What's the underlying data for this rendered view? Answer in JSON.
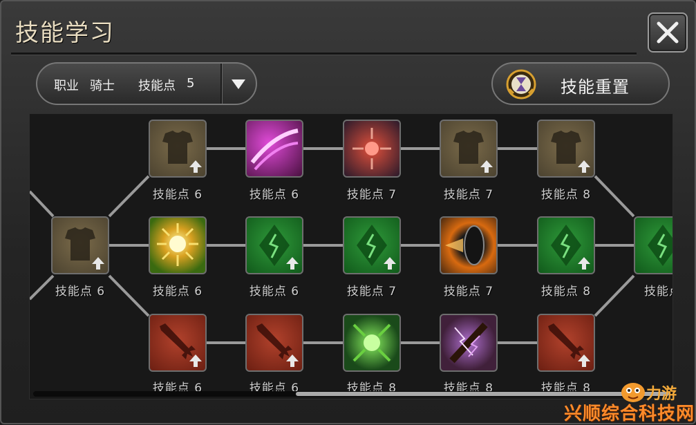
{
  "window": {
    "title": "技能学习",
    "close_icon": "close-icon"
  },
  "class_select": {
    "class_label": "职业",
    "class_value": "骑士",
    "points_label": "技能点",
    "points_value": "5",
    "dropdown_icon": "chevron-down-icon"
  },
  "reset_button": {
    "label": "技能重置",
    "icon": "hourglass-emblem-icon"
  },
  "skill_tree": {
    "nodes": [
      {
        "id": "r2c0",
        "icon": "armor-icon",
        "cost_text": "技能点 6",
        "upgrade": true
      },
      {
        "id": "r1c1",
        "icon": "armor-icon",
        "cost_text": "技能点 6",
        "upgrade": true
      },
      {
        "id": "r2c1",
        "icon": "sunburst-icon",
        "cost_text": "技能点 6",
        "upgrade": false
      },
      {
        "id": "r3c1",
        "icon": "sword-icon",
        "cost_text": "技能点 6",
        "upgrade": true
      },
      {
        "id": "r1c2",
        "icon": "purple-slash-icon",
        "cost_text": "技能点 6",
        "upgrade": false
      },
      {
        "id": "r2c2",
        "icon": "green-rune-icon",
        "cost_text": "技能点 6",
        "upgrade": true
      },
      {
        "id": "r3c2",
        "icon": "sword-icon",
        "cost_text": "技能点 6",
        "upgrade": true
      },
      {
        "id": "r1c3",
        "icon": "crimson-burst-icon",
        "cost_text": "技能点 7",
        "upgrade": false
      },
      {
        "id": "r2c3",
        "icon": "green-rune-icon",
        "cost_text": "技能点 7",
        "upgrade": true
      },
      {
        "id": "r3c3",
        "icon": "poison-burst-icon",
        "cost_text": "技能点 8",
        "upgrade": false
      },
      {
        "id": "r1c4",
        "icon": "armor-icon",
        "cost_text": "技能点 7",
        "upgrade": true
      },
      {
        "id": "r2c4",
        "icon": "flame-shield-icon",
        "cost_text": "技能点 7",
        "upgrade": false
      },
      {
        "id": "r3c4",
        "icon": "lightning-blade-icon",
        "cost_text": "技能点 8",
        "upgrade": false
      },
      {
        "id": "r1c5",
        "icon": "armor-icon",
        "cost_text": "技能点 8",
        "upgrade": true
      },
      {
        "id": "r2c5",
        "icon": "green-rune-icon",
        "cost_text": "技能点 8",
        "upgrade": true
      },
      {
        "id": "r3c5",
        "icon": "sword-icon",
        "cost_text": "技能点 8",
        "upgrade": true
      },
      {
        "id": "r2c6",
        "icon": "green-rune-icon",
        "cost_text": "技能点",
        "upgrade": true
      }
    ]
  },
  "watermark": {
    "top_text": "力游",
    "bottom_text": "兴顺综合科技网"
  },
  "colors": {
    "title_text": "#e8dcc0",
    "armor": "#6b5d40",
    "green": "#1f7a2a",
    "red": "#9a3020",
    "watermark": "#fb8a2a"
  }
}
